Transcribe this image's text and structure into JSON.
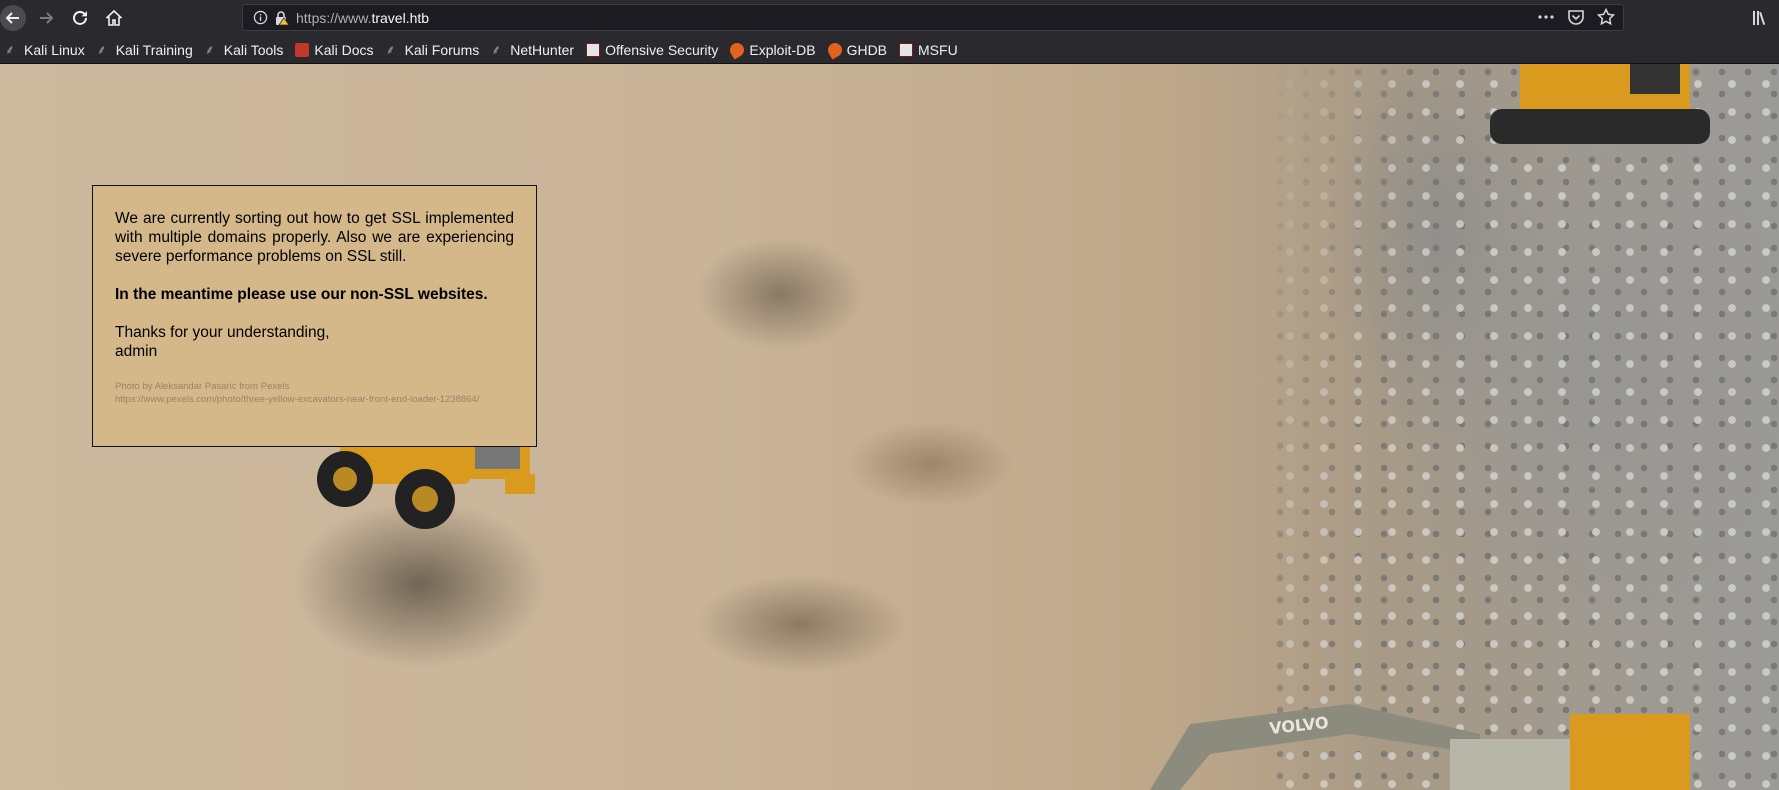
{
  "browser": {
    "url_prefix": "https://www.",
    "url_host": "travel.htb",
    "bookmarks": [
      {
        "label": "Kali Linux",
        "icon": "kali-dragon-icon"
      },
      {
        "label": "Kali Training",
        "icon": "kali-dragon-icon"
      },
      {
        "label": "Kali Tools",
        "icon": "kali-dragon-icon"
      },
      {
        "label": "Kali Docs",
        "icon": "kali-docs-icon"
      },
      {
        "label": "Kali Forums",
        "icon": "kali-dragon-icon"
      },
      {
        "label": "NetHunter",
        "icon": "nethunter-icon"
      },
      {
        "label": "Offensive Security",
        "icon": "offsec-icon"
      },
      {
        "label": "Exploit-DB",
        "icon": "exploitdb-icon"
      },
      {
        "label": "GHDB",
        "icon": "exploitdb-icon"
      },
      {
        "label": "MSFU",
        "icon": "offsec-icon"
      }
    ]
  },
  "notice": {
    "paragraph": "We are currently sorting out how to get SSL implemented with multiple domains properly. Also we are experiencing severe performance problems on SSL still.",
    "emphasis": "In the meantime please use our non-SSL websites.",
    "thanks": "Thanks for your understanding,",
    "signature": "admin",
    "credit_line1": "Photo by Aleksandar Pasaric from Pexels",
    "credit_line2": "https://www.pexels.com/photo/three-yellow-excavators-near-front-end-loader-1238864/"
  },
  "colors": {
    "notice_bg": "#d4b88a",
    "chrome_bg": "#2a2a2e",
    "machine_yellow": "#e0a21d"
  }
}
